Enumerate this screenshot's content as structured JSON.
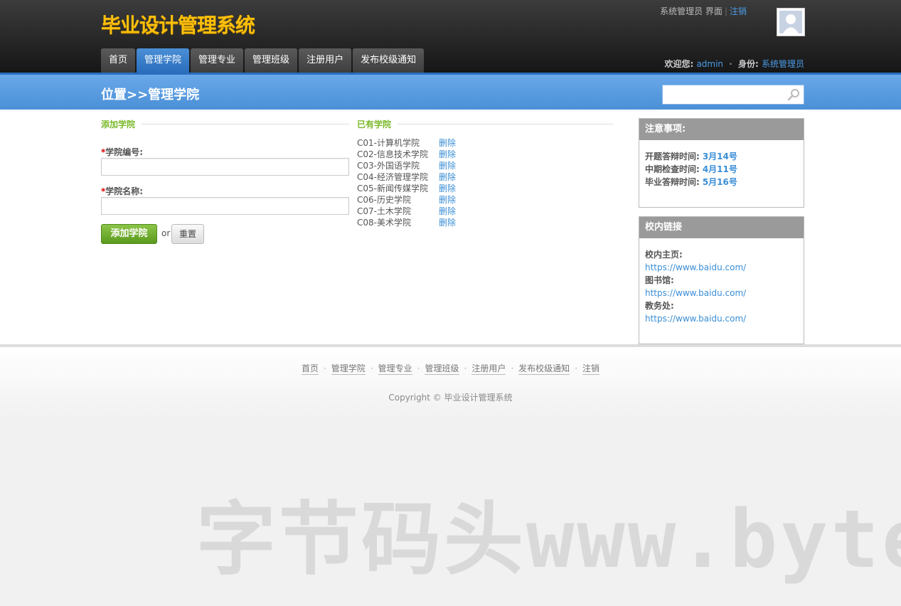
{
  "header": {
    "logo": "毕业设计管理系统",
    "tabs": [
      {
        "label": "首页",
        "active": false
      },
      {
        "label": "管理学院",
        "active": true
      },
      {
        "label": "管理专业",
        "active": false
      },
      {
        "label": "管理班级",
        "active": false
      },
      {
        "label": "注册用户",
        "active": false
      },
      {
        "label": "发布校级通知",
        "active": false
      }
    ],
    "role_interface": "系统管理员 界面",
    "logout": "注销",
    "welcome_label": "欢迎您:",
    "username": "admin",
    "identity_label": "身份:",
    "identity": "系统管理员"
  },
  "titlebar": {
    "location": "位置>>管理学院",
    "search_placeholder": ""
  },
  "add_form": {
    "section_title": "添加学院",
    "required_mark": "*",
    "code_label": "学院编号:",
    "code_value": "",
    "name_label": "学院名称:",
    "name_value": "",
    "add_button": "添加学院",
    "or": "or",
    "reset_button": "重置"
  },
  "existing": {
    "section_title": "已有学院",
    "delete_label": "删除",
    "colleges": [
      "C01-计算机学院",
      "C02-信息技术学院",
      "C03-外国语学院",
      "C04-经济管理学院",
      "C05-新闻传媒学院",
      "C06-历史学院",
      "C07-土木学院",
      "C08-美术学院"
    ]
  },
  "notice_box": {
    "title": "注意事项:",
    "items": [
      {
        "label": "开题答辩时间:",
        "value": "3月14号"
      },
      {
        "label": "中期检查时间:",
        "value": "4月11号"
      },
      {
        "label": "毕业答辩时间:",
        "value": "5月16号"
      }
    ]
  },
  "links_box": {
    "title": "校内链接",
    "items": [
      {
        "label": "校内主页:",
        "url": "https://www.baidu.com/"
      },
      {
        "label": "图书馆:",
        "url": "https://www.baidu.com/"
      },
      {
        "label": "教务处:",
        "url": "https://www.baidu.com/"
      }
    ]
  },
  "footer": {
    "links": [
      "首页",
      "管理学院",
      "管理专业",
      "管理班级",
      "注册用户",
      "发布校级通知",
      "注销"
    ],
    "copyright": "Copyright © 毕业设计管理系统"
  },
  "watermark": "字节码头www.byte",
  "colors": {
    "logo": "#fbbf0b",
    "active_tab": "#2a6ebd",
    "titlebar": "#4a8fd6",
    "section_title": "#7ab929",
    "link": "#3a8ed6",
    "add_button": "#5a9a1e"
  }
}
